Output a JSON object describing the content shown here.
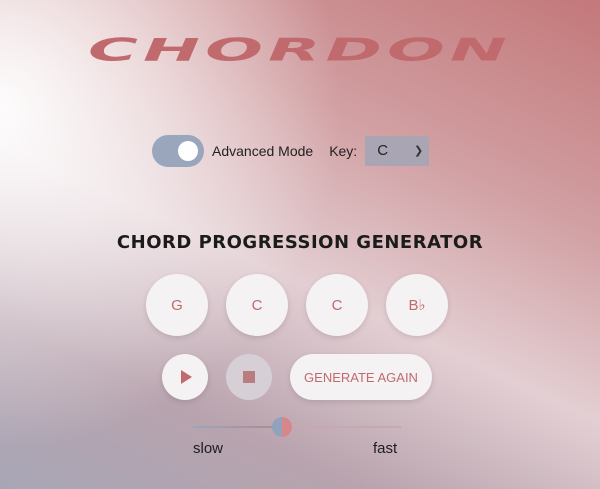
{
  "app": {
    "title": "CHORDON"
  },
  "controls": {
    "advanced_mode_label": "Advanced Mode",
    "advanced_mode_on": true,
    "key_label": "Key:",
    "key_value": "C"
  },
  "generator": {
    "heading": "CHORD PROGRESSION GENERATOR",
    "chords": [
      "G",
      "C",
      "C",
      "B♭"
    ],
    "generate_label": "GENERATE AGAIN"
  },
  "tempo": {
    "min_label": "slow",
    "max_label": "fast",
    "value_fraction": 0.43
  },
  "colors": {
    "accent": "#c06a6e",
    "toggle": "#9aa6bc",
    "button_bg": "#f5f2f3"
  },
  "icons": {
    "play": "play-icon",
    "stop": "stop-icon",
    "dropdown": "chevron-down-icon"
  }
}
